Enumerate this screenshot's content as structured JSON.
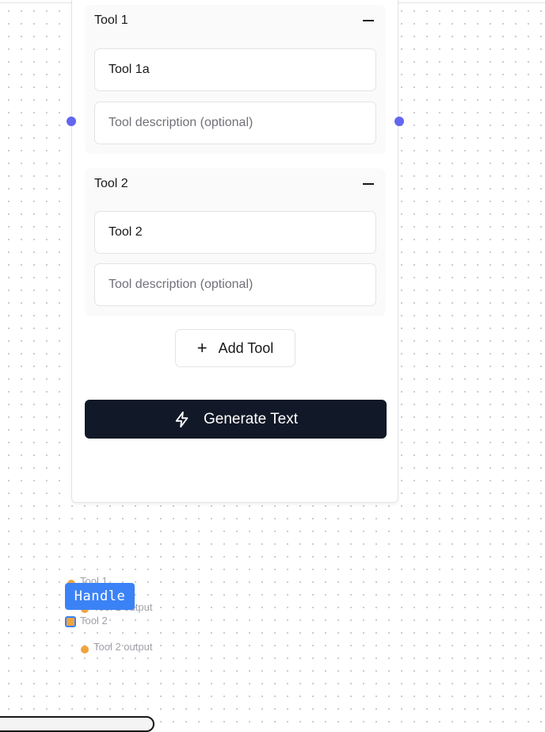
{
  "node": {
    "tools": [
      {
        "title": "Tool 1",
        "name_value": "Tool 1a",
        "description_placeholder": "Tool description (optional)"
      },
      {
        "title": "Tool 2",
        "name_value": "Tool 2",
        "description_placeholder": "Tool description (optional)"
      }
    ],
    "add_tool_label": "Add Tool",
    "add_tool_icon": "plus-icon",
    "generate_label": "Generate Text",
    "generate_icon": "lightning-icon"
  },
  "colors": {
    "handle": "#6366f1",
    "generate_bg": "#111827",
    "output_handle": "#f0a43c",
    "tooltip_bg": "#3b82f6"
  },
  "preview": {
    "items": [
      "Tool 1",
      "Tool 1 output",
      "Tool 2",
      "Tool 2 output"
    ]
  },
  "tooltip": {
    "text": "Handle"
  }
}
